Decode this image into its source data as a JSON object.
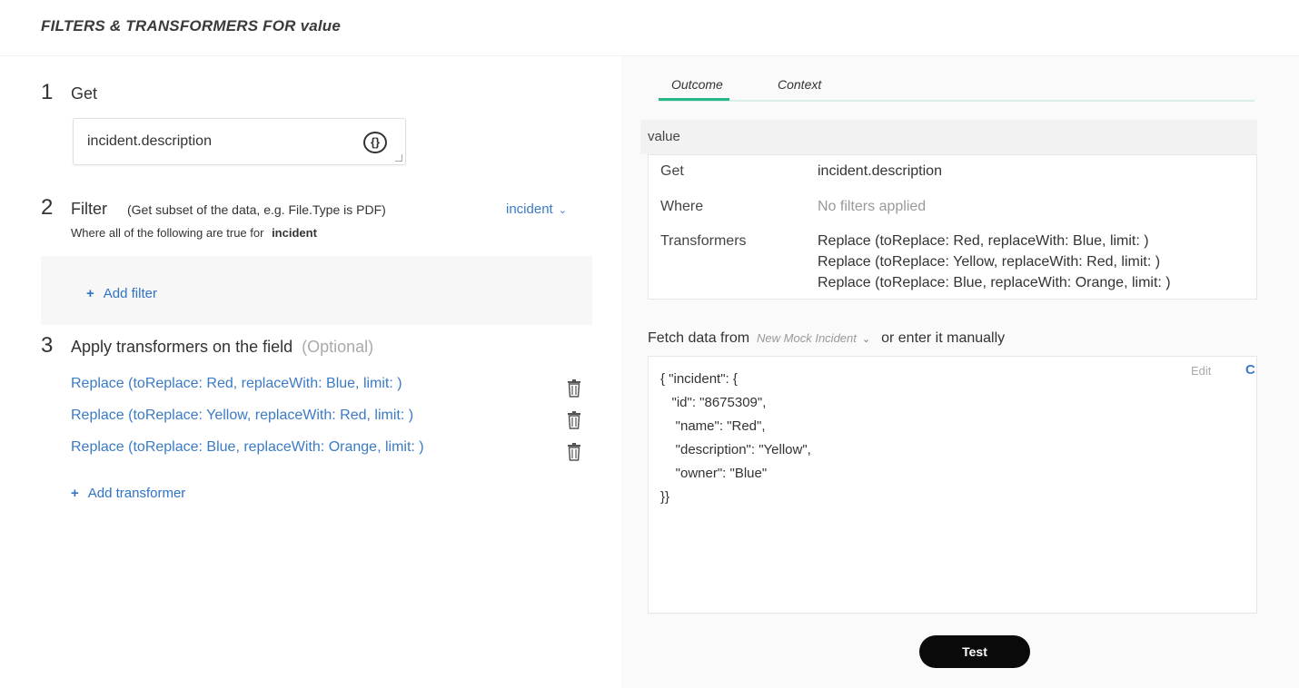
{
  "header": {
    "title": "FILTERS & TRANSFORMERS FOR value"
  },
  "left": {
    "step1": {
      "num": "1",
      "title": "Get",
      "input_value": "incident.description",
      "braces_glyph": "{}"
    },
    "step2": {
      "num": "2",
      "title": "Filter",
      "hint": "(Get subset of the data, e.g. File.Type is PDF)",
      "sub_prefix": "Where all of the following are true for",
      "sub_target": "incident",
      "selector": "incident",
      "add_label": "Add filter"
    },
    "step3": {
      "num": "3",
      "title": "Apply transformers on the field",
      "optional": "(Optional)",
      "transformers": [
        "Replace (toReplace: Red, replaceWith: Blue, limit: )",
        "Replace (toReplace: Yellow, replaceWith: Red, limit: )",
        "Replace (toReplace: Blue, replaceWith: Orange, limit: )"
      ],
      "add_label": "Add transformer"
    }
  },
  "right": {
    "tabs": [
      "Outcome",
      "Context"
    ],
    "active_tab": "Outcome",
    "value_label": "value",
    "summary": {
      "get_label": "Get",
      "get_value": "incident.description",
      "where_label": "Where",
      "where_value": "No filters applied",
      "transformers_label": "Transformers",
      "transformers": [
        "Replace (toReplace: Red, replaceWith: Blue, limit: )",
        "Replace (toReplace: Yellow, replaceWith: Red, limit: )",
        "Replace (toReplace: Blue, replaceWith: Orange, limit: )"
      ]
    },
    "fetch": {
      "prefix": "Fetch data from",
      "source": "New Mock Incident",
      "suffix": "or enter it manually"
    },
    "code_lines": [
      "{ \"incident\": {",
      "   \"id\": \"8675309\",",
      "    \"name\": \"Red\",",
      "    \"description\": \"Yellow\",",
      "    \"owner\": \"Blue\"",
      "}}"
    ],
    "edit_label": "Edit",
    "c_label": "C",
    "test_label": "Test"
  },
  "colors": {
    "link": "#3b7bc6",
    "tab_accent": "#27b58a",
    "button": "#0a0a0a"
  }
}
